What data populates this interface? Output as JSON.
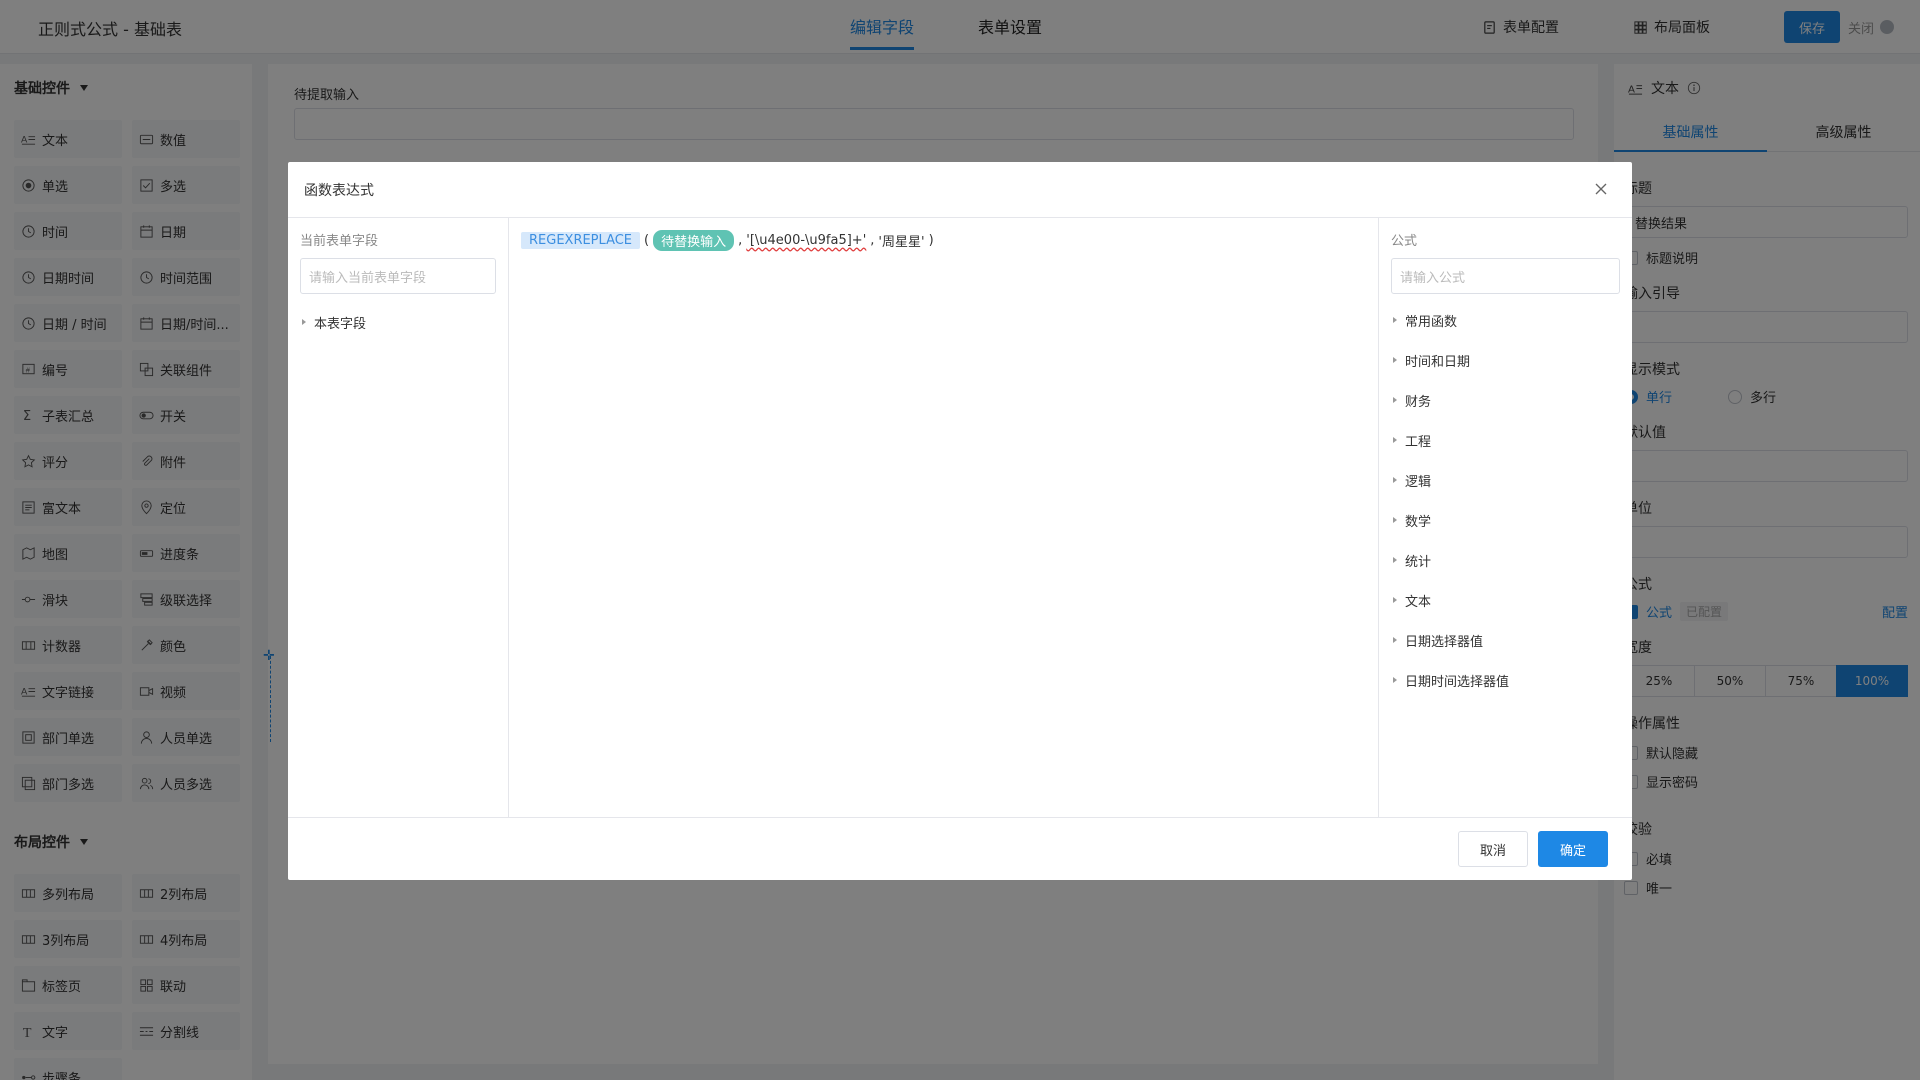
{
  "app": {
    "title": "正则式公式 - 基础表"
  },
  "top_tabs": [
    {
      "label": "编辑字段",
      "active": true
    },
    {
      "label": "表单设置",
      "active": false
    }
  ],
  "top_actions": {
    "form_config": "表单配置",
    "layout_panel": "布局面板",
    "save": "保存",
    "close": "关闭"
  },
  "sidebar": {
    "basic_title": "基础控件",
    "basic_items": [
      {
        "label": "文本",
        "icon": "text-icon"
      },
      {
        "label": "数值",
        "icon": "number-icon"
      },
      {
        "label": "单选",
        "icon": "radio-icon"
      },
      {
        "label": "多选",
        "icon": "checkbox-icon"
      },
      {
        "label": "时间",
        "icon": "clock-icon"
      },
      {
        "label": "日期",
        "icon": "calendar-icon"
      },
      {
        "label": "日期时间",
        "icon": "clock-icon"
      },
      {
        "label": "时间范围",
        "icon": "clock-icon"
      },
      {
        "label": "日期 / 时间",
        "icon": "clock-icon"
      },
      {
        "label": "日期/时间...",
        "icon": "calendar-icon"
      },
      {
        "label": "编号",
        "icon": "number-tag-icon"
      },
      {
        "label": "关联组件",
        "icon": "link-component-icon"
      },
      {
        "label": "子表汇总",
        "icon": "sigma-icon"
      },
      {
        "label": "开关",
        "icon": "switch-icon"
      },
      {
        "label": "评分",
        "icon": "star-icon"
      },
      {
        "label": "附件",
        "icon": "paperclip-icon"
      },
      {
        "label": "富文本",
        "icon": "rich-text-icon"
      },
      {
        "label": "定位",
        "icon": "location-icon"
      },
      {
        "label": "地图",
        "icon": "map-icon"
      },
      {
        "label": "进度条",
        "icon": "progress-icon"
      },
      {
        "label": "滑块",
        "icon": "slider-icon"
      },
      {
        "label": "级联选择",
        "icon": "cascade-icon"
      },
      {
        "label": "计数器",
        "icon": "counter-icon"
      },
      {
        "label": "颜色",
        "icon": "color-picker-icon"
      },
      {
        "label": "文字链接",
        "icon": "text-link-icon"
      },
      {
        "label": "视频",
        "icon": "video-icon"
      },
      {
        "label": "部门单选",
        "icon": "department-icon"
      },
      {
        "label": "人员单选",
        "icon": "user-icon"
      },
      {
        "label": "部门多选",
        "icon": "department-multi-icon"
      },
      {
        "label": "人员多选",
        "icon": "users-icon"
      }
    ],
    "layout_title": "布局控件",
    "layout_items": [
      {
        "label": "多列布局",
        "icon": "columns-icon"
      },
      {
        "label": "2列布局",
        "icon": "columns-icon"
      },
      {
        "label": "3列布局",
        "icon": "columns-icon"
      },
      {
        "label": "4列布局",
        "icon": "columns-icon"
      },
      {
        "label": "标签页",
        "icon": "tabs-icon"
      },
      {
        "label": "联动",
        "icon": "linkage-icon"
      },
      {
        "label": "文字",
        "icon": "text-t-icon"
      },
      {
        "label": "分割线",
        "icon": "divider-icon"
      },
      {
        "label": "步骤条",
        "icon": "steps-icon"
      }
    ]
  },
  "canvas": {
    "field_label": "待提取输入"
  },
  "right_panel": {
    "header": "文本",
    "tabs": [
      {
        "label": "基础属性",
        "active": true
      },
      {
        "label": "高级属性",
        "active": false
      }
    ],
    "title_label": "标题",
    "title_value": "替换结果",
    "title_desc": "标题说明",
    "input_hint_label": "输入引导",
    "display_mode_label": "显示模式",
    "display_single": "单行",
    "display_multi": "多行",
    "default_label": "默认值",
    "unit_label": "单位",
    "formula_section": "公式",
    "formula_check": "公式",
    "formula_tag": "已配置",
    "formula_config": "配置",
    "width_label": "宽度",
    "width_options": [
      "25%",
      "50%",
      "75%",
      "100%"
    ],
    "width_selected": "100%",
    "ops_label": "操作属性",
    "ops_hidden": "默认隐藏",
    "ops_password": "显示密码",
    "validate_label": "校验",
    "validate_required": "必填",
    "validate_unique": "唯一"
  },
  "modal": {
    "title": "函数表达式",
    "left_title": "当前表单字段",
    "left_placeholder": "请输入当前表单字段",
    "left_tree": [
      "本表字段"
    ],
    "expression": {
      "function": "REGEXREPLACE",
      "open_paren": "(",
      "field": "待替换输入",
      "sep1": ",",
      "arg_pattern": "'[\\u4e00-\\u9fa5]+'",
      "sep2": ",",
      "arg_replace": "'周星星'",
      "close_paren": ")"
    },
    "right_title": "公式",
    "right_placeholder": "请输入公式",
    "categories": [
      "常用函数",
      "时间和日期",
      "财务",
      "工程",
      "逻辑",
      "数学",
      "统计",
      "文本",
      "日期选择器值",
      "日期时间选择器值"
    ],
    "cancel": "取消",
    "confirm": "确定"
  }
}
